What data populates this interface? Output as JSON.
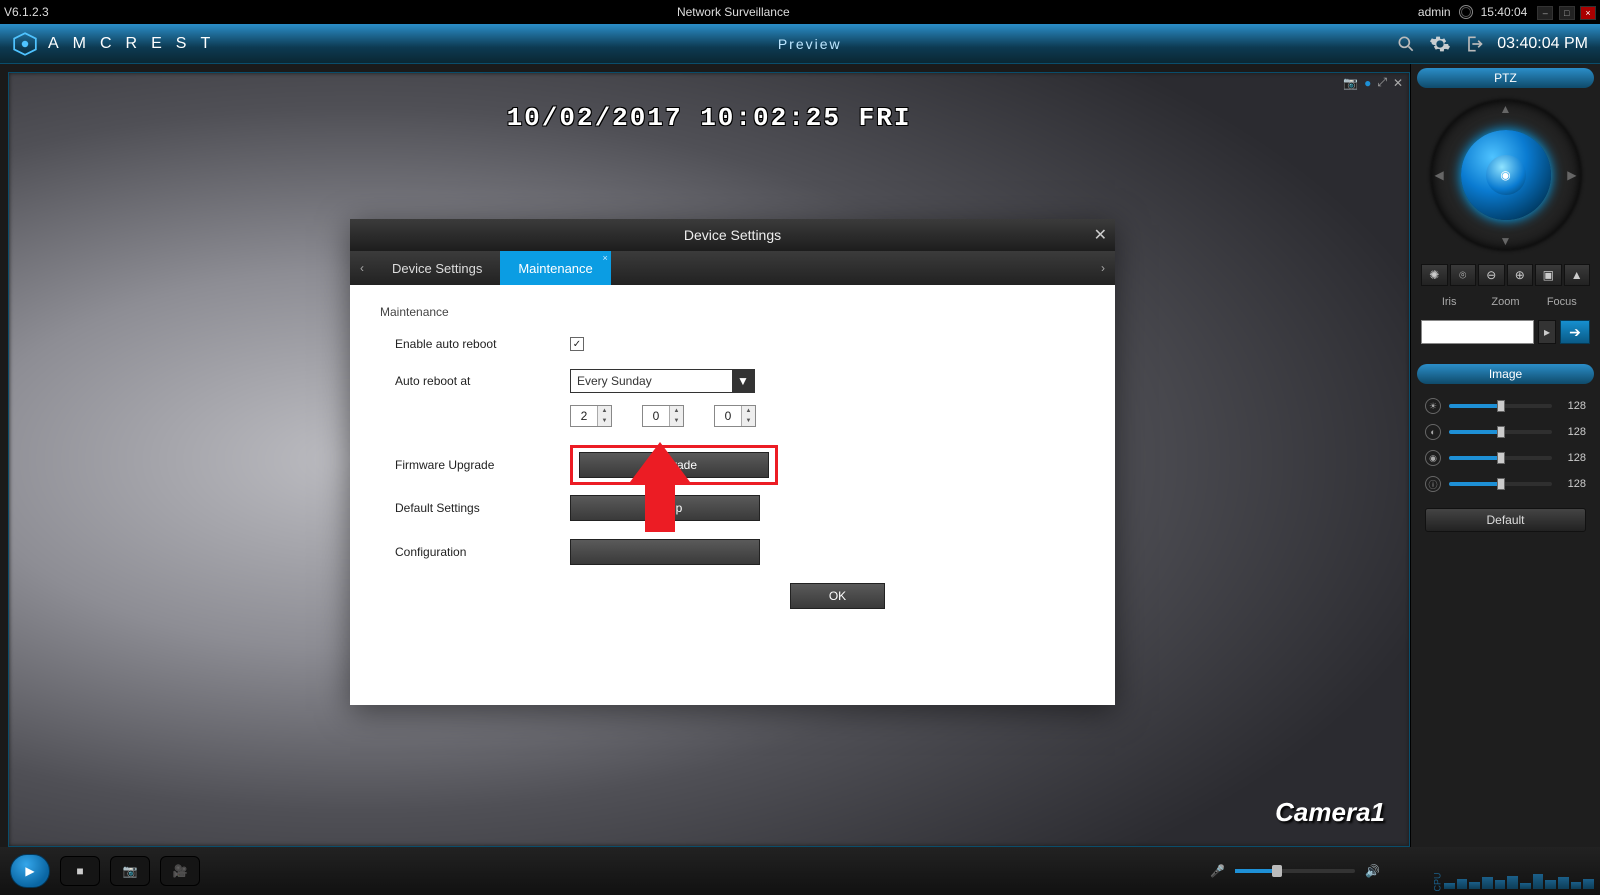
{
  "window": {
    "version": "V6.1.2.3",
    "title": "Network Surveillance",
    "user": "admin",
    "clock": "15:40:04"
  },
  "header": {
    "brand": "AMCREST",
    "center": "Preview",
    "clock": "03:40:04 PM"
  },
  "video": {
    "osd_top": "10/02/2017 10:02:25 FRI",
    "osd_camera": "Camera1"
  },
  "side": {
    "ptz_title": "PTZ",
    "labels": {
      "iris": "Iris",
      "zoom": "Zoom",
      "focus": "Focus"
    },
    "image_title": "Image",
    "sliders": {
      "brightness": 128,
      "contrast": 128,
      "saturation": 128,
      "gamma": 128
    },
    "default_btn": "Default",
    "preset_value": ""
  },
  "dialog": {
    "title": "Device Settings",
    "tabs": {
      "device_settings": "Device Settings",
      "maintenance": "Maintenance"
    },
    "maintenance": {
      "section": "Maintenance",
      "enable_auto_reboot": "Enable auto reboot",
      "auto_reboot_at": "Auto reboot at",
      "schedule": "Every Sunday",
      "time_h": "2",
      "time_m": "0",
      "time_s": "0",
      "firmware_upgrade_label": "Firmware Upgrade",
      "upgrade_btn": "Upgrade",
      "default_settings_label": "Default Settings",
      "default_settings_btn": "Set up",
      "configuration_label": "Configuration",
      "configuration_btn": " ",
      "ok": "OK"
    }
  }
}
